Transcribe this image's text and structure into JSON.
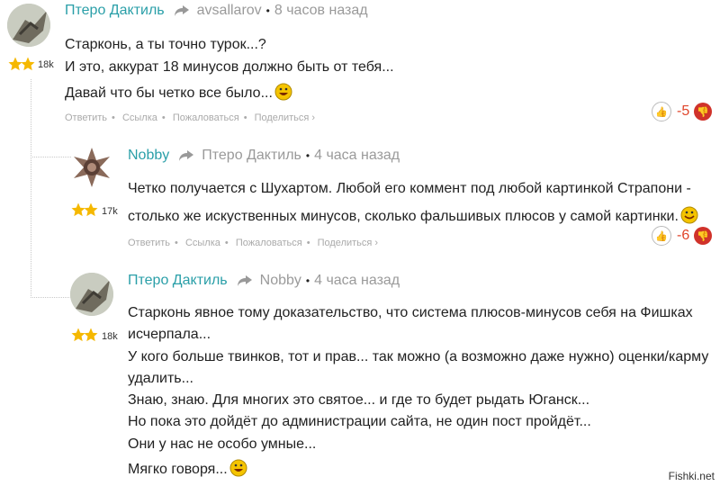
{
  "comments": [
    {
      "author": "Птеро Дактиль",
      "reply_to": "avsallarov",
      "time": "8 часов назад",
      "karma": "18k",
      "lines": [
        "Старконь, а ты точно турок...?",
        "И это, аккурат 18 минусов должно быть от тебя...",
        "Давай что бы четко все было..."
      ],
      "score": "-5"
    },
    {
      "author": "Nobby",
      "reply_to": "Птеро Дактиль",
      "time": "4 часа назад",
      "karma": "17k",
      "lines": [
        "Четко получается с Шухартом. Любой его коммент под любой картинкой Страпони -",
        "столько же искуственных минусов, сколько фальшивых плюсов у самой картинки."
      ],
      "score": "-6"
    },
    {
      "author": "Птеро Дактиль",
      "reply_to": "Nobby",
      "time": "4 часа назад",
      "karma": "18k",
      "lines": [
        "Старконь явное тому доказательство, что система плюсов-минусов себя на Фишках",
        "исчерпала...",
        "У кого больше твинков, тот и прав... так можно (а возможно даже нужно) оценки/карму",
        "удалить...",
        "Знаю, знаю. Для многих это святое... и где то будет рыдать Юганск...",
        "Но пока это дойдёт до администрации сайта, не один пост пройдёт...",
        "Они у нас не особо умные...",
        "Мягко говоря..."
      ]
    }
  ],
  "actions": {
    "reply": "Ответить",
    "link": "Ссылка",
    "report": "Пожаловаться",
    "share": "Поделиться ›"
  },
  "watermark": "Fishki.net",
  "colors": {
    "author": "#2a9fa8",
    "meta": "#9a9a9a",
    "score": "#e0452b",
    "downvote": "#d0322a",
    "star": "#f5b800"
  },
  "icons": [
    "share-arrow-icon",
    "star-icon",
    "smiley-icon",
    "thumb-up-icon",
    "thumb-down-icon"
  ]
}
